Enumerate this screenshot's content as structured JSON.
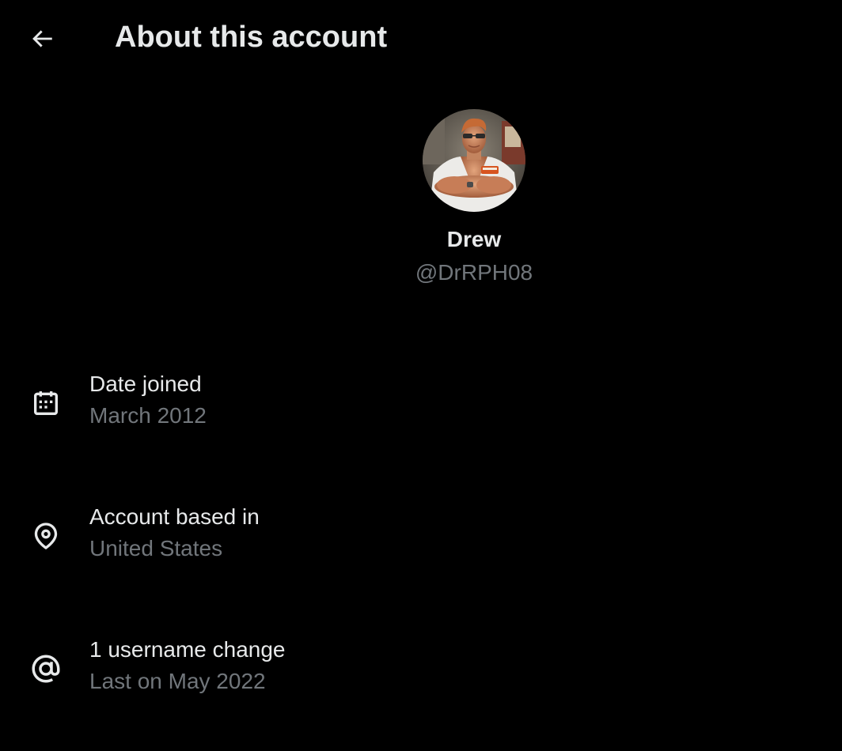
{
  "header": {
    "title": "About this account",
    "back_icon": "arrow-left-icon"
  },
  "profile": {
    "display_name": "Drew",
    "handle": "@DrRPH08"
  },
  "info": {
    "date_joined": {
      "icon": "calendar-icon",
      "title": "Date joined",
      "value": "March 2012"
    },
    "based_in": {
      "icon": "location-pin-icon",
      "title": "Account based in",
      "value": "United States"
    },
    "username_changes": {
      "icon": "at-sign-icon",
      "title": "1 username change",
      "value": "Last on May 2022"
    }
  },
  "colors": {
    "background": "#000000",
    "primary_text": "#e7e9ea",
    "secondary_text": "#71767b"
  }
}
